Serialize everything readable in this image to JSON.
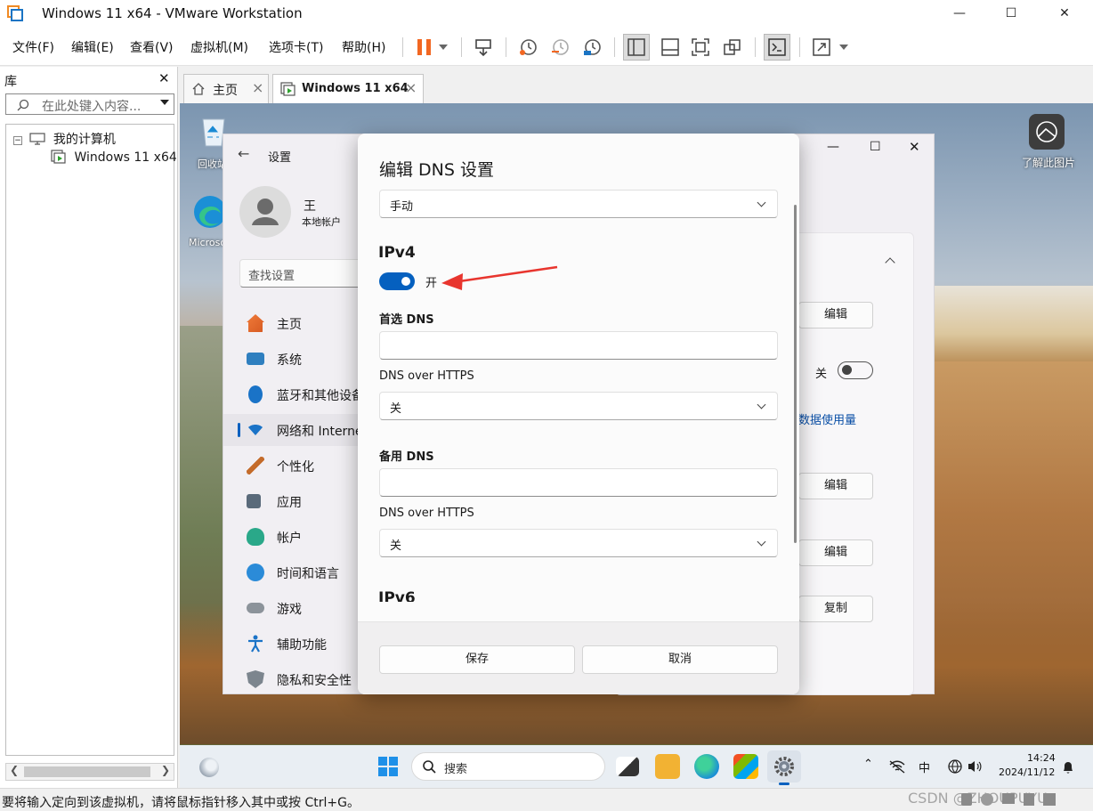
{
  "window": {
    "title": "Windows 11 x64 - VMware Workstation"
  },
  "menubar": {
    "items": [
      "文件(F)",
      "编辑(E)",
      "查看(V)",
      "虚拟机(M)",
      "选项卡(T)",
      "帮助(H)"
    ]
  },
  "library": {
    "title": "库",
    "search_placeholder": "在此处键入内容...",
    "tree": [
      {
        "label": "我的计算机"
      },
      {
        "label": "Windows 11 x64"
      }
    ]
  },
  "tabs": [
    {
      "label": "主页"
    },
    {
      "label": "Windows 11 x64"
    }
  ],
  "desktop": {
    "icons": [
      {
        "label": "回收站"
      },
      {
        "label": "Microsoft Edge"
      }
    ],
    "learn_more": "了解此图片"
  },
  "settings": {
    "header": "设置",
    "user_name": "王",
    "user_type": "本地帐户",
    "search_placeholder": "查找设置",
    "nav": [
      "主页",
      "系统",
      "蓝牙和其他设备",
      "网络和 Internet",
      "个性化",
      "应用",
      "帐户",
      "时间和语言",
      "游戏",
      "辅助功能",
      "隐私和安全性"
    ],
    "right": {
      "edit_label": "编辑",
      "copy_label": "复制",
      "off_label": "关",
      "link": "数据使用量"
    }
  },
  "dialog": {
    "title": "编辑 DNS 设置",
    "mode": "手动",
    "ipv4_heading": "IPv4",
    "toggle_label": "开",
    "toggle_on": true,
    "preferred_dns_label": "首选 DNS",
    "preferred_dns_value": "",
    "doh_label_1": "DNS over HTTPS",
    "doh_value_1": "关",
    "alternate_dns_label": "备用 DNS",
    "alternate_dns_value": "",
    "doh_label_2": "DNS over HTTPS",
    "doh_value_2": "关",
    "ipv6_heading": "IPv6",
    "save": "保存",
    "cancel": "取消"
  },
  "taskbar": {
    "search": "搜索",
    "time": "14:24",
    "date": "2024/11/12",
    "ime": "中"
  },
  "statusbar": {
    "text": "要将输入定向到该虚拟机，请将鼠标指针移入其中或按 Ctrl+G。",
    "watermark": "CSDN @ZHOUPUYU"
  },
  "colors": {
    "accent": "#0560bf",
    "annotation_arrow": "#e8352e",
    "pause_orange": "#f26722"
  }
}
